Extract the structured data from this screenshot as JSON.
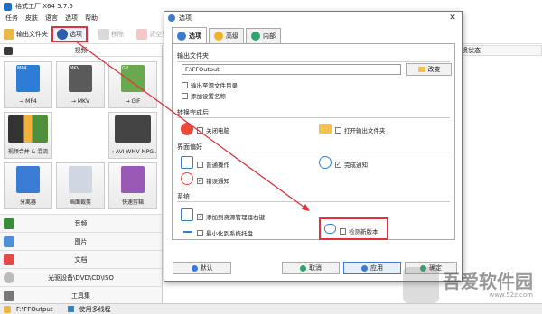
{
  "app": {
    "title": "格式工厂 X64 5.7.5",
    "menu": [
      "任务",
      "皮肤",
      "语言",
      "选项",
      "帮助"
    ],
    "toolbar": {
      "output_folder": "输出文件夹",
      "options": "选项",
      "remove": "移除",
      "clear_list": "清空列表"
    },
    "right_header": "转换状态",
    "categories": {
      "video": "视频",
      "image": "图片",
      "document": "文档",
      "rom": "光驱设备\\DVD\\CD\\ISO",
      "tools": "工具集"
    },
    "video_tiles": [
      "→ MP4",
      "→ MKV",
      "→ GIF",
      "视频合并 & 混流",
      "",
      "→ AVI WMV MPG ...",
      "分离器",
      "画面裁剪",
      "快速剪辑"
    ],
    "tile_badges": [
      "MP4",
      "MKV",
      "Gif"
    ],
    "status": {
      "path": "F:\\FFOutput",
      "multithread": "使用多线程"
    }
  },
  "dialog": {
    "title": "选项",
    "tabs": [
      "选项",
      "高级",
      "内部"
    ],
    "sections": {
      "output": "输出文件夹",
      "after": "转换完成后",
      "interface": "界面偏好",
      "system": "系统"
    },
    "output_path": "F:\\FFOutput",
    "browse": "改变",
    "output_to_source": "输出至源文件目录",
    "add_name": "添加设置名称",
    "shutdown": "关闭电脑",
    "open_folder": "打开输出文件夹",
    "normal_op": "普通操作",
    "finish_notify": "完成通知",
    "error_notify": "错误通知",
    "context_menu": "添加到资源管理器右键",
    "check_update": "检测新版本",
    "minimize_tray": "最小化到系统托盘",
    "buttons": {
      "default": "默认",
      "cancel": "取消",
      "apply": "应用",
      "ok": "确定"
    }
  },
  "watermark": {
    "brand": "吾爱软件园",
    "url": "www.52z.com"
  },
  "colors": {
    "highlight": "#e0323c",
    "accent": "#1f6fc4",
    "check_blue": "#2a83d4"
  }
}
